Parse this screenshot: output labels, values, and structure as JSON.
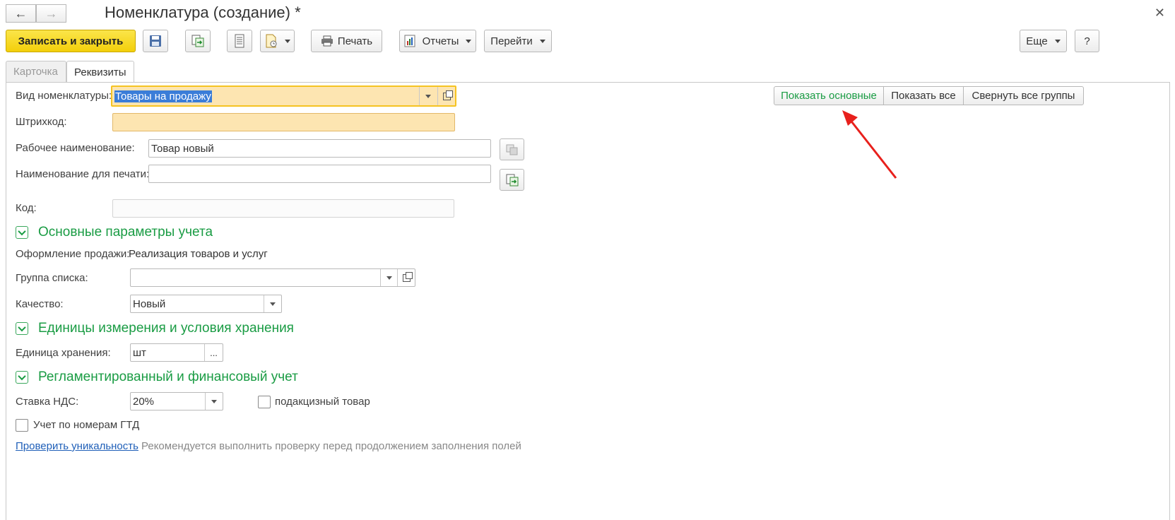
{
  "window": {
    "title": "Номенклатура (создание) *"
  },
  "toolbar": {
    "save_close_label": "Записать и закрыть",
    "print_label": "Печать",
    "reports_label": "Отчеты",
    "goto_label": "Перейти",
    "more_label": "Еще",
    "help_label": "?"
  },
  "tabs": [
    {
      "label": "Карточка",
      "active": false
    },
    {
      "label": "Реквизиты",
      "active": true
    }
  ],
  "view_buttons": {
    "show_main": "Показать основные",
    "show_all": "Показать все",
    "collapse_groups": "Свернуть все группы"
  },
  "fields": {
    "item_kind": {
      "label": "Вид номенклатуры:",
      "value": "Товары на продажу"
    },
    "barcode": {
      "label": "Штрихкод:",
      "value": ""
    },
    "working_name": {
      "label": "Рабочее наименование:",
      "value": "Товар новый"
    },
    "print_name": {
      "label": "Наименование для печати:",
      "value": ""
    },
    "code": {
      "label": "Код:",
      "value": ""
    }
  },
  "sections": {
    "main_params": {
      "title": "Основные параметры учета",
      "sale_registration_label": "Оформление продажи:",
      "sale_registration_value": "Реализация товаров и услуг",
      "list_group_label": "Группа списка:",
      "list_group_value": "",
      "quality_label": "Качество:",
      "quality_value": "Новый"
    },
    "units": {
      "title": "Единицы измерения и условия хранения",
      "storage_unit_label": "Единица хранения:",
      "storage_unit_value": "шт",
      "picker_label": "..."
    },
    "regulated": {
      "title": "Регламентированный и финансовый учет",
      "vat_label": "Ставка НДС:",
      "vat_value": "20%",
      "excise_label": "подакцизный товар",
      "gtd_label": "Учет по номерам ГТД"
    }
  },
  "uniqueness": {
    "link": "Проверить уникальность",
    "hint": "Рекомендуется выполнить проверку перед продолжением заполнения полей"
  },
  "colors": {
    "accent_yellow": "#f5d20f",
    "section_green": "#1a9c44",
    "required_fill": "#fde5b1",
    "annotation_red": "#e8201c"
  }
}
